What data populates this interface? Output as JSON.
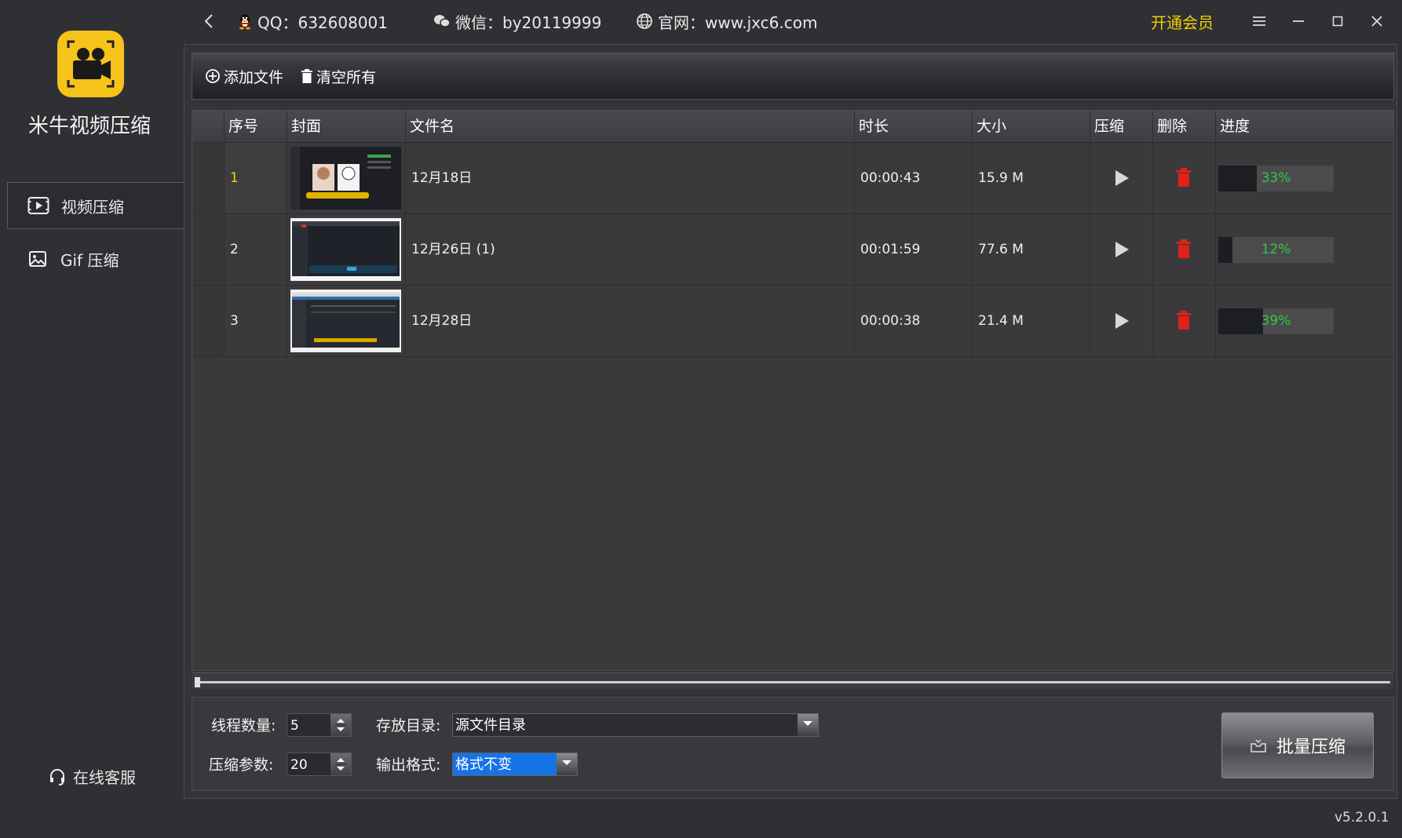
{
  "app": {
    "title": "米牛视频压缩",
    "version": "v5.2.0.1"
  },
  "colors": {
    "logo_bg": "#f7c21a",
    "vip": "#f0d100",
    "progress_text": "#2ecc40",
    "delete_icon": "#e0201a"
  },
  "sidebar": {
    "items": [
      {
        "label": "视频压缩",
        "icon": "video-icon",
        "active": true
      },
      {
        "label": "Gif 压缩",
        "icon": "image-icon",
        "active": false
      }
    ],
    "support_label": "在线客服"
  },
  "titlebar": {
    "qq": "QQ：632608001",
    "wechat": "微信：by20119999",
    "website": "官网：www.jxc6.com",
    "vip_label": "开通会员"
  },
  "toolbar": {
    "add_label": "添加文件",
    "clear_label": "清空所有"
  },
  "table": {
    "headers": [
      "序号",
      "封面",
      "文件名",
      "时长",
      "大小",
      "压缩",
      "删除",
      "进度"
    ],
    "rows": [
      {
        "index": "1",
        "name": "12月18日",
        "duration": "00:00:43",
        "size": "15.9 M",
        "progress": 33,
        "progress_label": "33%",
        "selected": true
      },
      {
        "index": "2",
        "name": "12月26日 (1)",
        "duration": "00:01:59",
        "size": "77.6 M",
        "progress": 12,
        "progress_label": "12%",
        "selected": false
      },
      {
        "index": "3",
        "name": "12月28日",
        "duration": "00:00:38",
        "size": "21.4 M",
        "progress": 39,
        "progress_label": "39%",
        "selected": false
      }
    ]
  },
  "settings": {
    "threads_label": "线程数量:",
    "threads_value": "5",
    "param_label": "压缩参数:",
    "param_value": "20",
    "dir_label": "存放目录:",
    "dir_value": "源文件目录",
    "format_label": "输出格式:",
    "format_value": "格式不变",
    "batch_label": "批量压缩"
  }
}
